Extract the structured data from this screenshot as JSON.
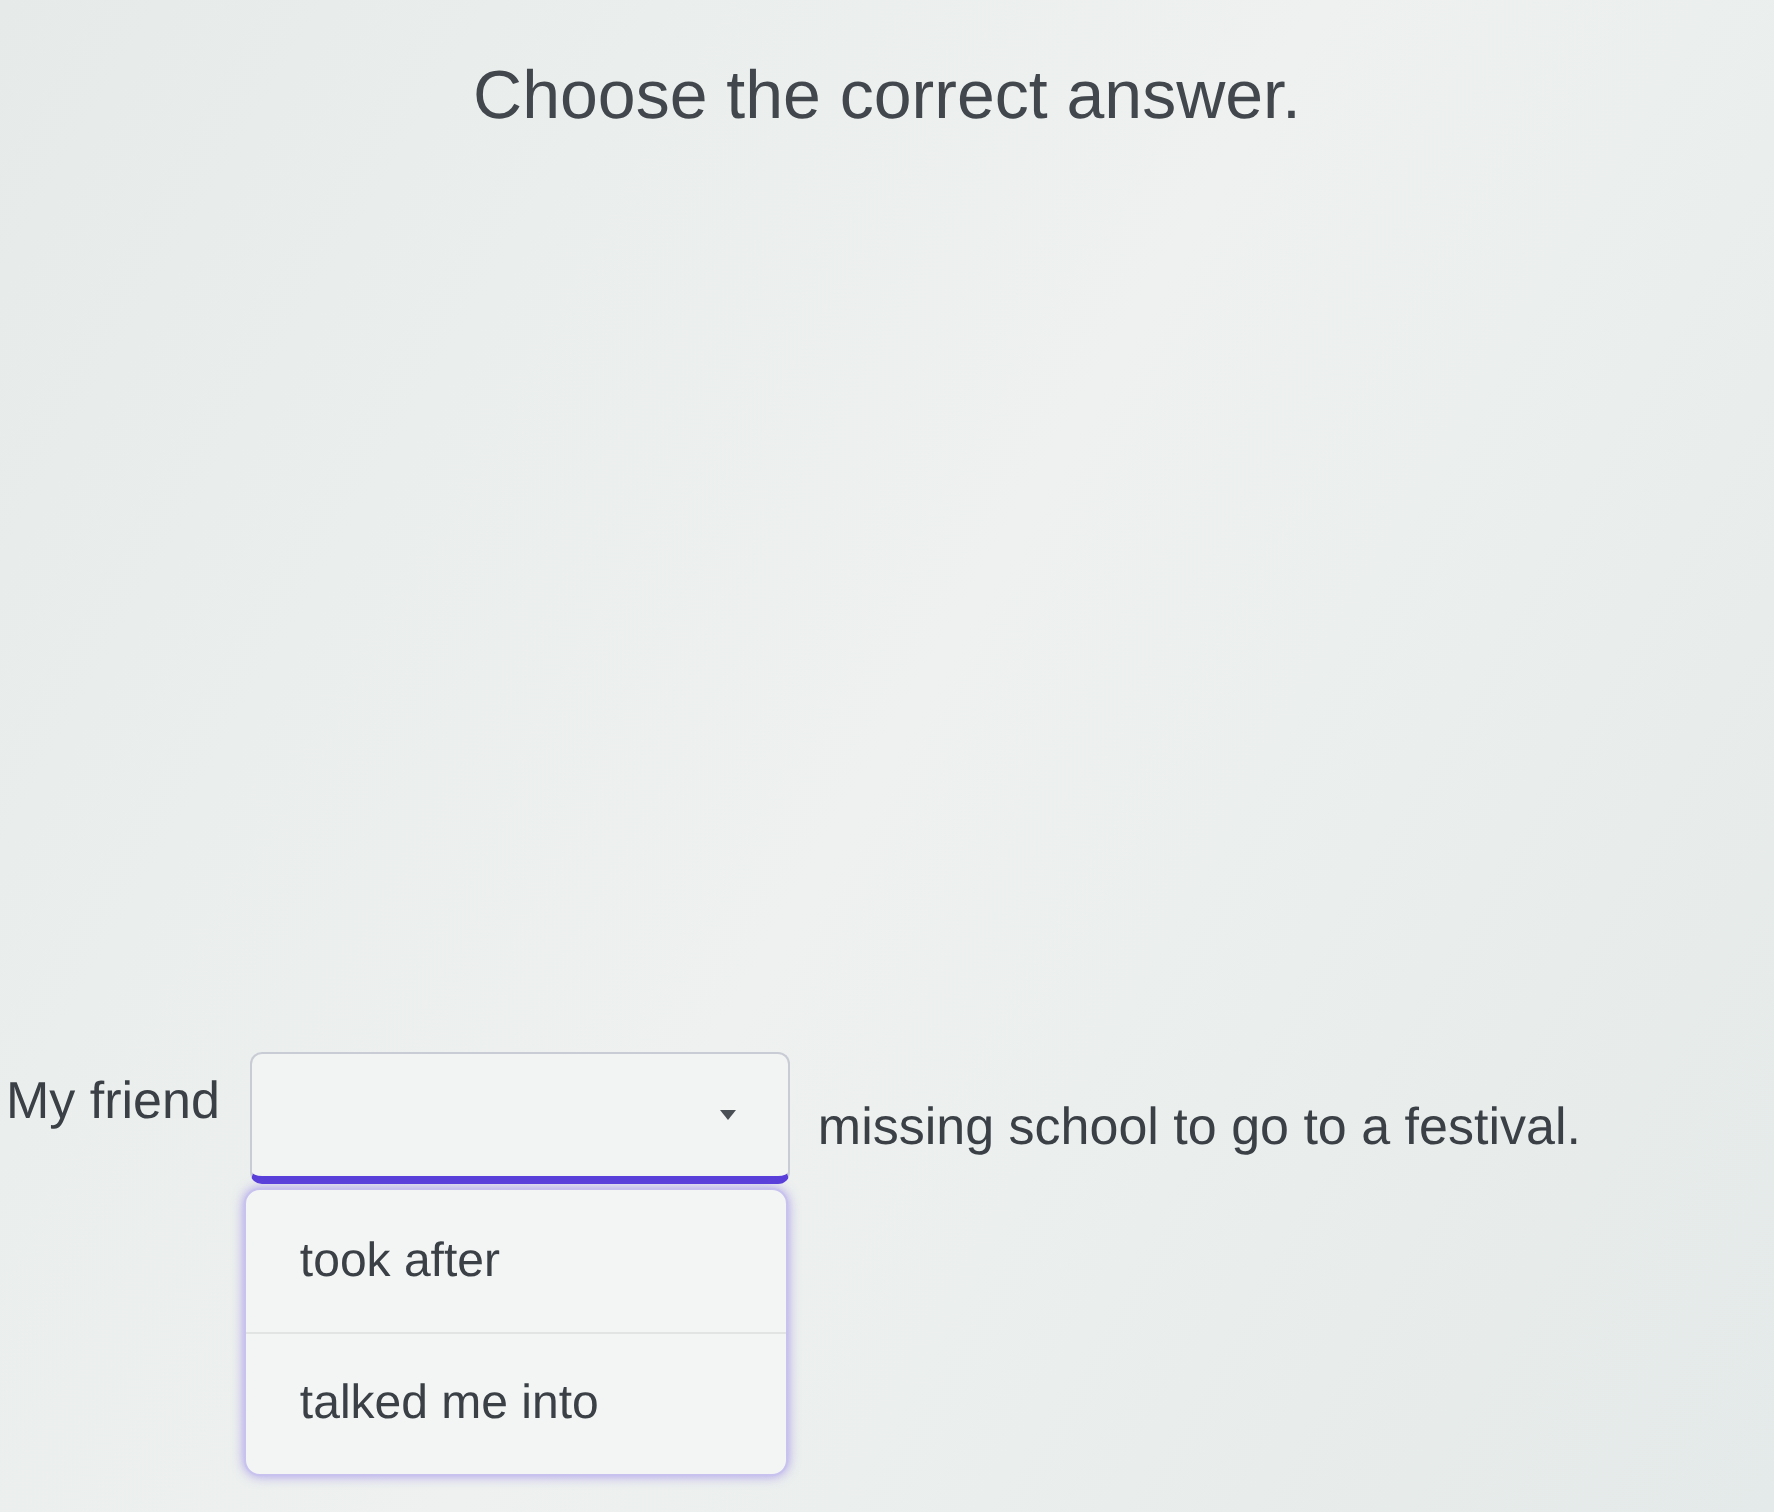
{
  "instruction": "Choose the correct answer.",
  "question": {
    "before": "My friend",
    "after": "missing school to go to a festival.",
    "dropdown": {
      "expanded": true,
      "options": [
        {
          "label": "took after",
          "selected": false
        },
        {
          "label": "talked me into",
          "selected": false
        }
      ]
    }
  }
}
